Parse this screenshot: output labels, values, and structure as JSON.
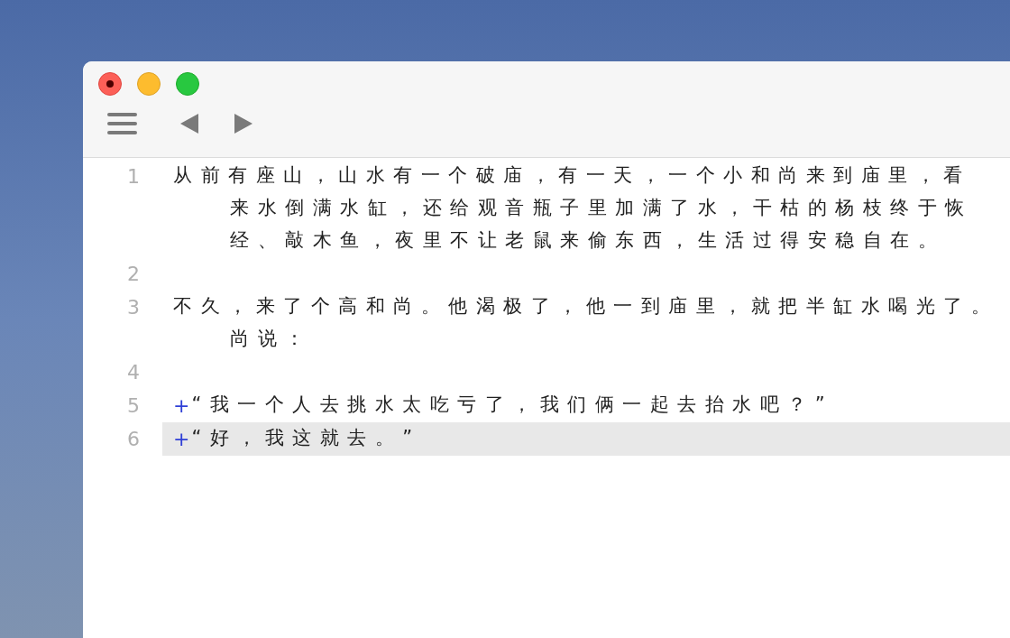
{
  "lines": [
    {
      "number": "1",
      "highlighted": false,
      "segments": [
        "从前有座山，山水有一个破庙，有一天，一个小和尚来到庙里，看",
        "来水倒满水缸，还给观音瓶子里加满了水，干枯的杨枝终于恢",
        "经、敲木鱼，夜里不让老鼠来偷东西，生活过得安稳自在。"
      ]
    },
    {
      "number": "2",
      "highlighted": false
    },
    {
      "number": "3",
      "highlighted": false,
      "segments": [
        "不久，来了个高和尚。他渴极了，他一到庙里，就把半缸水喝光了。",
        "尚说："
      ]
    },
    {
      "number": "4",
      "highlighted": false
    },
    {
      "number": "5",
      "highlighted": false,
      "marker": "+",
      "segments": [
        "“我一个人去挑水太吃亏了，我们俩一起去抬水吧？”"
      ]
    },
    {
      "number": "6",
      "highlighted": true,
      "marker": "+",
      "segments": [
        "“好，我这就去。”"
      ]
    }
  ]
}
